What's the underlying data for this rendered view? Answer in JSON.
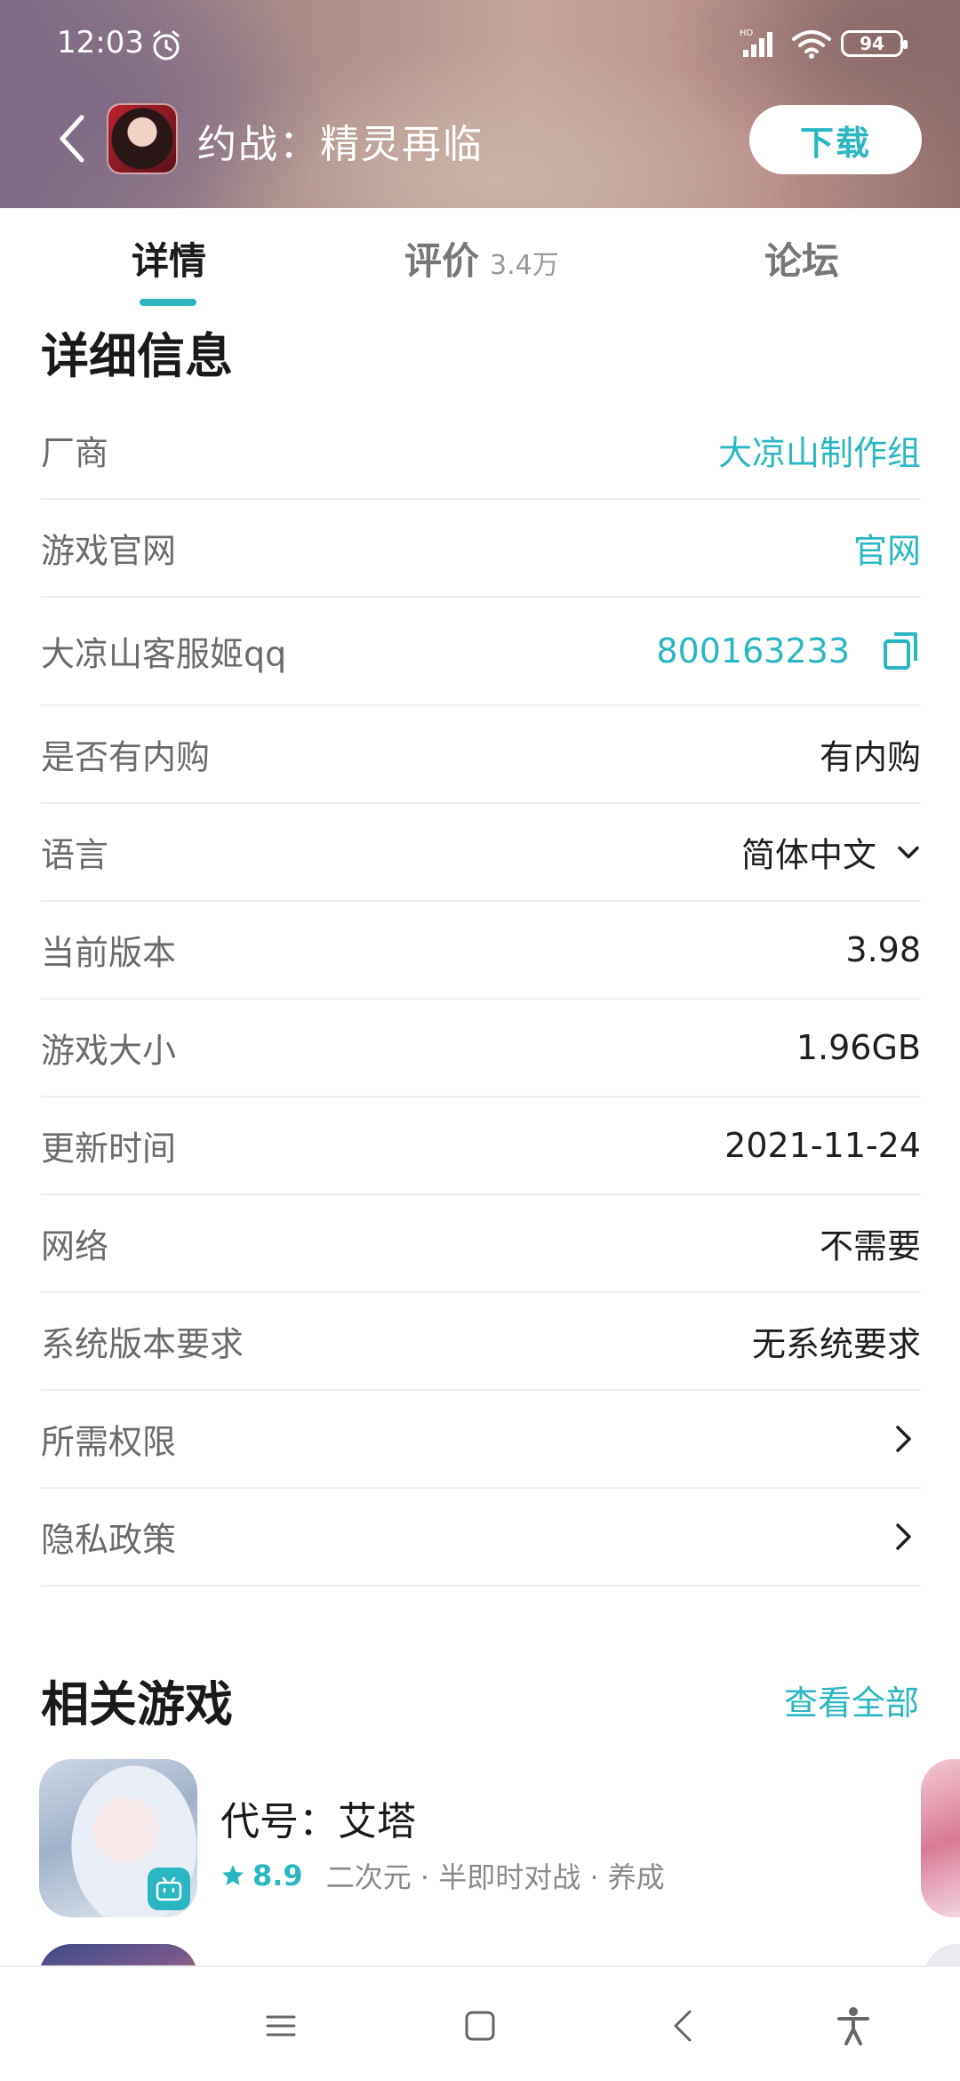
{
  "status_bar": {
    "time": "12:03",
    "signal_label": "HD",
    "battery": "94"
  },
  "header": {
    "back_icon": "chevron-left-icon",
    "app_title": "约战：精灵再临",
    "download_label": "下载"
  },
  "tabs": [
    {
      "label": "详情",
      "active": true
    },
    {
      "label": "评价",
      "count": "3.4万"
    },
    {
      "label": "论坛"
    }
  ],
  "details": {
    "title": "详细信息",
    "rows": [
      {
        "label": "厂商",
        "value": "大凉山制作组"
      },
      {
        "label": "游戏官网",
        "value": "官网"
      },
      {
        "label": "大凉山客服姬qq",
        "value": "800163233"
      },
      {
        "label": "是否有内购",
        "value": "有内购"
      },
      {
        "label": "语言",
        "value": "简体中文"
      },
      {
        "label": "当前版本",
        "value": "3.98"
      },
      {
        "label": "游戏大小",
        "value": "1.96GB"
      },
      {
        "label": "更新时间",
        "value": "2021-11-24"
      },
      {
        "label": "网络",
        "value": "不需要"
      },
      {
        "label": "系统版本要求",
        "value": "无系统要求"
      },
      {
        "label": "所需权限"
      },
      {
        "label": "隐私政策"
      }
    ]
  },
  "related": {
    "title": "相关游戏",
    "view_all": "查看全部",
    "games": [
      {
        "name": "代号：艾塔",
        "score": "8.9",
        "tags": "二次元 · 半即时对战 · 养成"
      }
    ]
  },
  "colors": {
    "accent": "#2ab7c2"
  }
}
